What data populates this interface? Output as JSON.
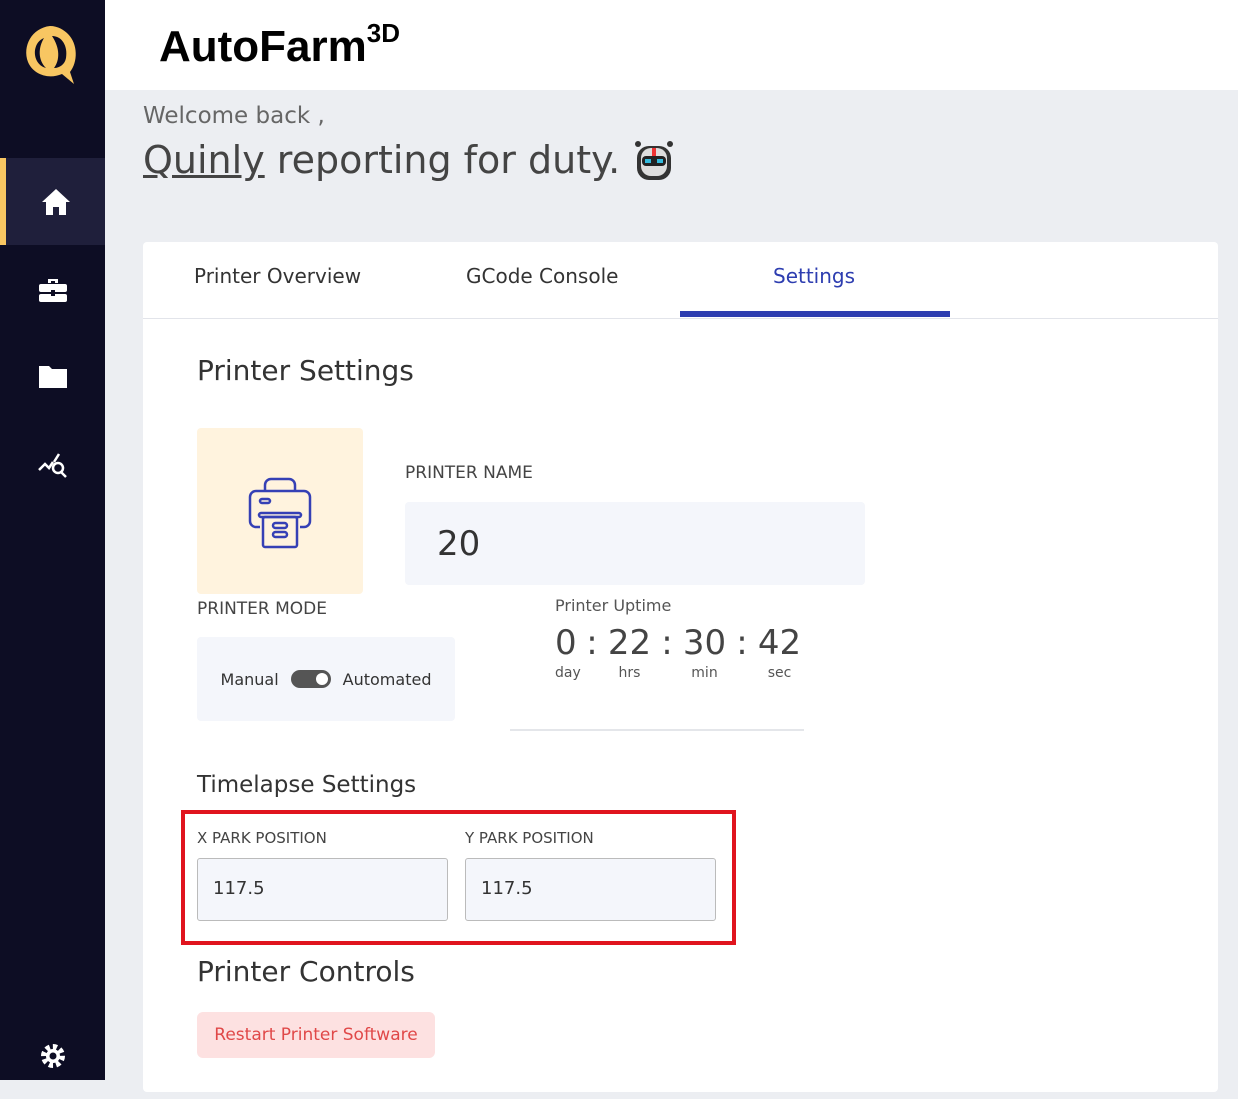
{
  "app": {
    "brand": "AutoFarm",
    "brand_sup": "3D"
  },
  "sidebar": {
    "items": [
      {
        "icon": "home-icon",
        "active": true
      },
      {
        "icon": "briefcase-icon"
      },
      {
        "icon": "folder-icon"
      },
      {
        "icon": "analytics-search-icon"
      }
    ],
    "bottom_icon": "gear-icon",
    "accent": "#f8c662"
  },
  "greeting": {
    "welcome": "Welcome back ,",
    "name": "Quinly",
    "rest": "reporting for duty."
  },
  "tabs": [
    {
      "label": "Printer Overview"
    },
    {
      "label": "GCode Console"
    },
    {
      "label": "Settings",
      "active": true
    }
  ],
  "settings": {
    "title": "Printer Settings",
    "printer_name_label": "PRINTER NAME",
    "printer_name": "20",
    "mode_label": "PRINTER MODE",
    "mode_left": "Manual",
    "mode_right": "Automated",
    "uptime": {
      "label": "Printer Uptime",
      "day": "0",
      "hrs": "22",
      "min": "30",
      "sec": "42",
      "day_u": "day",
      "hrs_u": "hrs",
      "min_u": "min",
      "sec_u": "sec"
    },
    "timelapse_title": "Timelapse Settings",
    "x_label": "X PARK POSITION",
    "x_value": "117.5",
    "y_label": "Y PARK POSITION",
    "y_value": "117.5",
    "controls_title": "Printer Controls",
    "restart_label": "Restart Printer Software"
  }
}
